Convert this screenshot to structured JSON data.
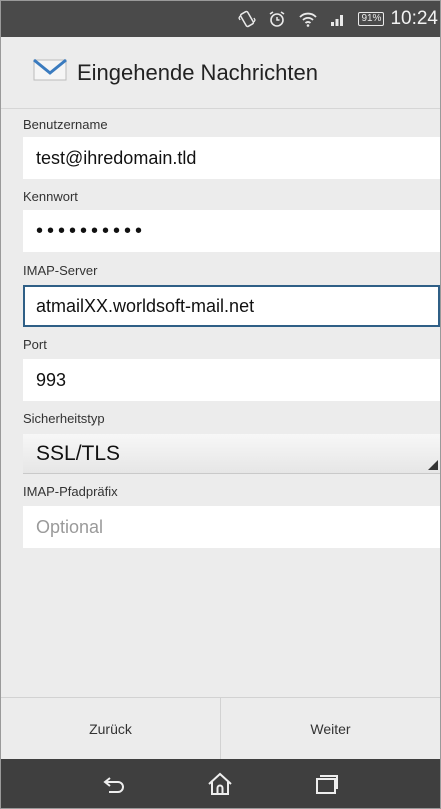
{
  "status_bar": {
    "battery": "91%",
    "time": "10:24",
    "icons": [
      "vibrate-icon",
      "alarm-icon",
      "wifi-icon",
      "signal-icon",
      "battery-icon"
    ]
  },
  "header": {
    "title": "Eingehende Nachrichten",
    "icon": "mail-envelope-icon"
  },
  "form": {
    "username": {
      "label": "Benutzername",
      "value": "test@ihredomain.tld"
    },
    "password": {
      "label": "Kennwort",
      "value": "••••••••••"
    },
    "imap_server": {
      "label": "IMAP-Server",
      "value": "atmailXX.worldsoft-mail.net"
    },
    "port": {
      "label": "Port",
      "value": "993"
    },
    "security_type": {
      "label": "Sicherheitstyp",
      "value": "SSL/TLS"
    },
    "imap_prefix": {
      "label": "IMAP-Pfadpräfix",
      "placeholder": "Optional"
    }
  },
  "buttons": {
    "back": "Zurück",
    "next": "Weiter"
  },
  "nav_bar": {
    "icons": [
      "back-icon",
      "home-icon",
      "recent-apps-icon"
    ]
  },
  "colors": {
    "status_bar": "#4a4a4a",
    "nav_bar": "#3f3f3f",
    "focus_border": "#2f5f86",
    "mail_icon": "#3a7bbf"
  }
}
